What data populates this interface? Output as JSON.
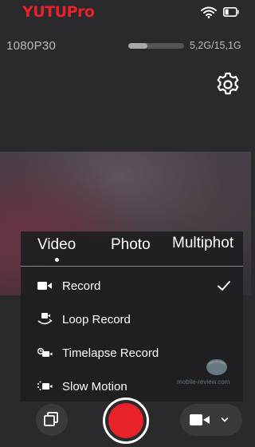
{
  "app": {
    "logo_text": "YUTUPro",
    "accent_color": "#e8222a"
  },
  "status": {
    "wifi_icon": "wifi-icon",
    "battery_icon": "battery-icon"
  },
  "info": {
    "resolution": "1080P30",
    "storage": "5,2G/15,1G",
    "storage_used_fraction": 0.34
  },
  "settings": {
    "icon": "gear-icon"
  },
  "mode_menu": {
    "tabs": [
      {
        "label": "Video",
        "selected": true
      },
      {
        "label": "Photo",
        "selected": false
      },
      {
        "label": "Multiphot",
        "selected": false
      }
    ],
    "items": [
      {
        "label": "Record",
        "icon": "video-camera-icon",
        "selected": true
      },
      {
        "label": "Loop Record",
        "icon": "loop-record-icon",
        "selected": false
      },
      {
        "label": "Timelapse Record",
        "icon": "timelapse-icon",
        "selected": false
      },
      {
        "label": "Slow Motion",
        "icon": "slow-motion-icon",
        "selected": false
      }
    ]
  },
  "watermark": {
    "text": "mobile-review.com"
  },
  "bottom_bar": {
    "gallery_icon": "gallery-icon",
    "record_color": "#e82229",
    "mode_icon": "video-camera-icon",
    "dropdown_icon": "chevron-down-icon"
  }
}
